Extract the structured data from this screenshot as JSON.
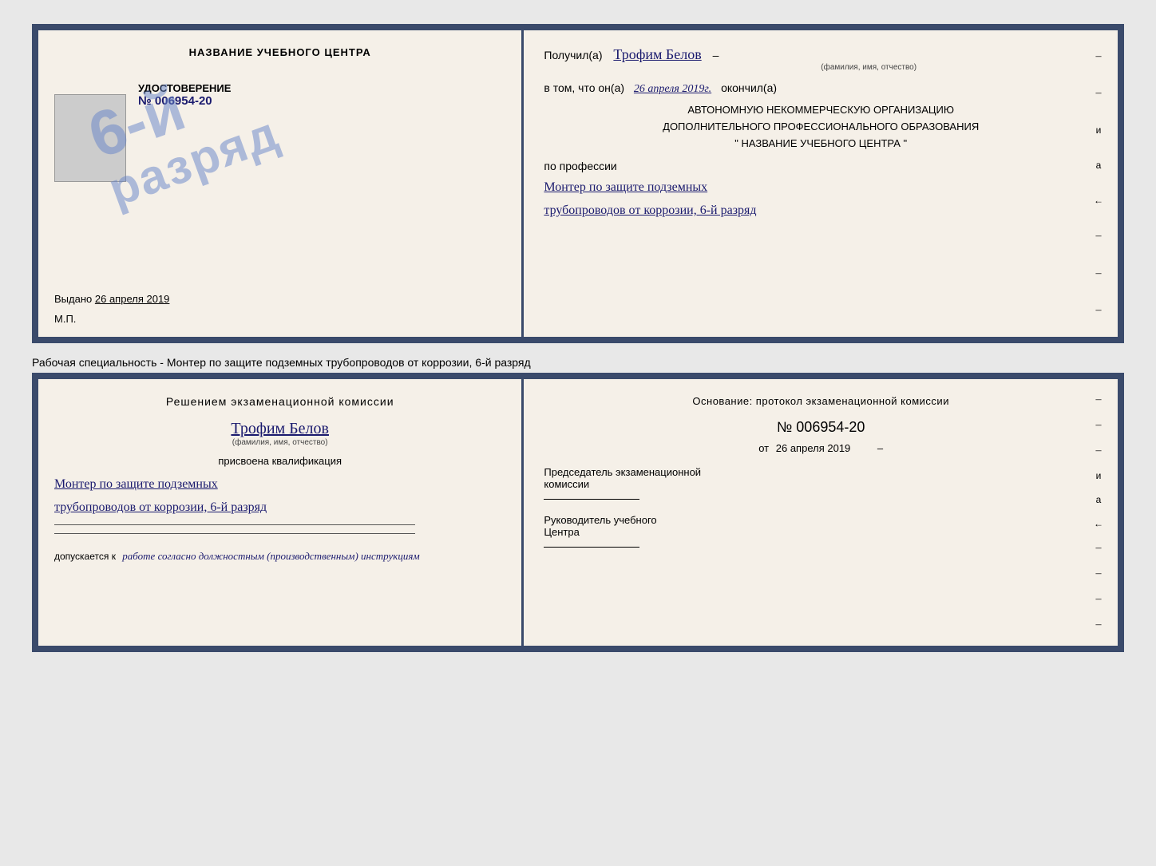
{
  "page": {
    "background_color": "#e8e8e8"
  },
  "diploma": {
    "left": {
      "title": "НАЗВАНИЕ УЧЕБНОГО ЦЕНТРА",
      "photo_alt": "Фото",
      "udostoverenie_label": "УДОСТОВЕРЕНИЕ",
      "number": "№ 006954-20",
      "stamp_text": "6-й разряд",
      "vydano_label": "Выдано",
      "vydano_date": "26 апреля 2019",
      "mp_label": "М.П."
    },
    "right": {
      "poluchil_label": "Получил(а)",
      "recipient_name": "Трофим Белов",
      "fio_sublabel": "(фамилия, имя, отчество)",
      "dash": "–",
      "v_tom_label": "в том, что он(а)",
      "date_handwritten": "26 апреля 2019г.",
      "okonchil_label": "окончил(а)",
      "org_line1": "АВТОНОМНУЮ НЕКОММЕРЧЕСКУЮ ОРГАНИЗАЦИЮ",
      "org_line2": "ДОПОЛНИТЕЛЬНОГО ПРОФЕССИОНАЛЬНОГО ОБРАЗОВАНИЯ",
      "org_line3": "\"   НАЗВАНИЕ УЧЕБНОГО ЦЕНТРА   \"",
      "po_professii_label": "по профессии",
      "profession_line1": "Монтер по защите подземных",
      "profession_line2": "трубопроводов от коррозии, 6-й разряд",
      "side_labels": [
        "–",
        "–",
        "и",
        "а",
        "←",
        "–",
        "–",
        "–"
      ]
    }
  },
  "between": {
    "text": "Рабочая специальность - Монтер по защите подземных трубопроводов от коррозии, 6-й разряд"
  },
  "bottom_cert": {
    "left": {
      "resheniem_label": "Решением экзаменационной комиссии",
      "name_handwritten": "Трофим Белов",
      "fio_sublabel": "(фамилия, имя, отчество)",
      "prisvoena_label": "присвоена квалификация",
      "qualification_line1": "Монтер по защите подземных",
      "qualification_line2": "трубопроводов от коррозии, 6-й разряд",
      "dopuskaetsya_label": "допускается к",
      "dopuskaetsya_text": "работе согласно должностным (производственным) инструкциям"
    },
    "right": {
      "osnovanie_label": "Основание: протокол экзаменационной комиссии",
      "nomer": "№ 006954-20",
      "ot_label": "от",
      "ot_date": "26 апреля 2019",
      "predsedatel_line1": "Председатель экзаменационной",
      "predsedatel_line2": "комиссии",
      "rukovoditel_line1": "Руководитель учебного",
      "rukovoditel_line2": "Центра",
      "side_labels": [
        "–",
        "–",
        "–",
        "и",
        "а",
        "←",
        "–",
        "–",
        "–",
        "–"
      ]
    }
  }
}
